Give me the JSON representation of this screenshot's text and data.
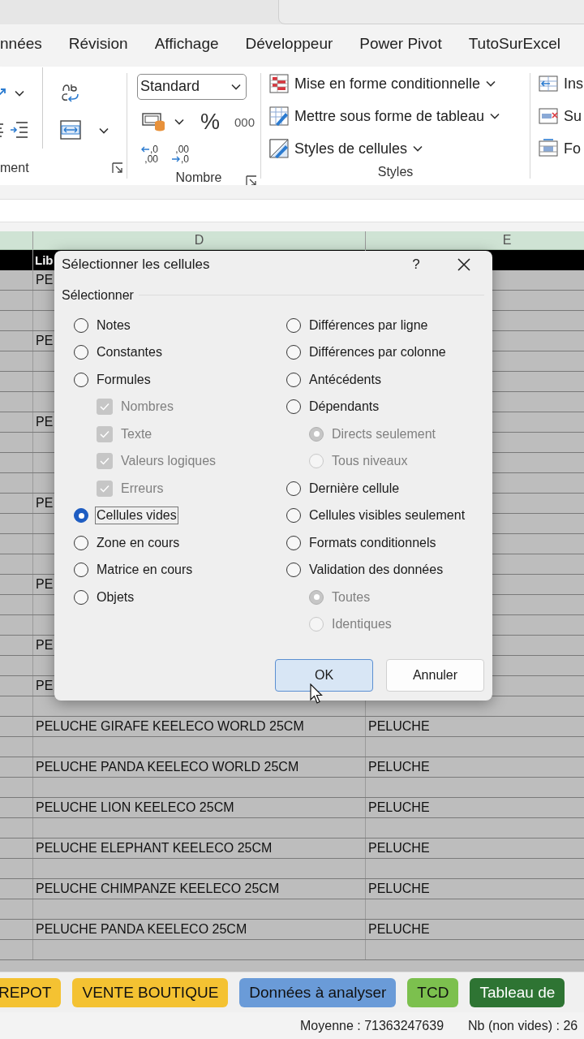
{
  "menu_tabs": [
    {
      "label": "nnées",
      "selected": false
    },
    {
      "label": "Révision",
      "selected": false
    },
    {
      "label": "Affichage",
      "selected": false
    },
    {
      "label": "Développeur",
      "selected": false
    },
    {
      "label": "Power Pivot",
      "selected": false
    },
    {
      "label": "TutoSurExcel",
      "selected": false
    }
  ],
  "ribbon": {
    "groups": [
      {
        "kind": "alignment",
        "label": "ment"
      },
      {
        "kind": "number",
        "label": "Nombre",
        "format": "Standard",
        "percent": "%",
        "thousands": "000",
        "decimal_buttons": [
          {
            "lines": [
              ",0",
              ",00"
            ]
          },
          {
            "lines": [
              ",00",
              ",0"
            ]
          }
        ]
      },
      {
        "kind": "styles",
        "label": "Styles",
        "items": [
          "Mise en forme conditionnelle",
          "Mettre sous forme de tableau",
          "Styles de cellules"
        ]
      },
      {
        "kind": "cells",
        "items": [
          "Ins",
          "Su",
          "Fo"
        ]
      }
    ]
  },
  "sheet": {
    "columns": [
      "D",
      "E"
    ],
    "header": "Lib",
    "rows": [
      {
        "d": "PE"
      },
      {},
      {},
      {
        "d": "PE"
      },
      {},
      {},
      {},
      {
        "d": "PE"
      },
      {},
      {},
      {},
      {
        "d": "PE"
      },
      {},
      {},
      {},
      {
        "d": "PE"
      },
      {},
      {},
      {
        "d": "PE"
      },
      {},
      {
        "d": "PE"
      },
      {},
      {
        "d": "PELUCHE GIRAFE KEELECO WORLD 25CM",
        "e": "PELUCHE"
      },
      {},
      {
        "d": "PELUCHE PANDA KEELECO WORLD 25CM",
        "e": "PELUCHE"
      },
      {},
      {
        "d": "PELUCHE LION KEELECO 25CM",
        "e": "PELUCHE"
      },
      {},
      {
        "d": "PELUCHE ELEPHANT KEELECO 25CM",
        "e": "PELUCHE"
      },
      {},
      {
        "d": "PELUCHE CHIMPANZE KEELECO 25CM",
        "e": "PELUCHE"
      },
      {},
      {
        "d": "PELUCHE PANDA KEELECO 25CM",
        "e": "PELUCHE"
      },
      {}
    ]
  },
  "dialog": {
    "title": "Sélectionner les cellules",
    "help_button": "?",
    "group_label": "Sélectionner",
    "columns": [
      [
        {
          "kind": "radio",
          "label": "Notes",
          "selected": false,
          "disabled": false,
          "focused": false
        },
        {
          "kind": "radio",
          "label": "Constantes",
          "selected": false,
          "disabled": false,
          "focused": false
        },
        {
          "kind": "radio",
          "label": "Formules",
          "selected": false,
          "disabled": false,
          "focused": false,
          "children": [
            {
              "kind": "checkbox",
              "label": "Nombres",
              "checked": true,
              "disabled": true,
              "focused": false
            },
            {
              "kind": "checkbox",
              "label": "Texte",
              "checked": true,
              "disabled": true,
              "focused": false
            },
            {
              "kind": "checkbox",
              "label": "Valeurs logiques",
              "checked": true,
              "disabled": true,
              "focused": false
            },
            {
              "kind": "checkbox",
              "label": "Erreurs",
              "checked": true,
              "disabled": true,
              "focused": false
            }
          ]
        },
        {
          "kind": "radio",
          "label": "Cellules vides",
          "selected": true,
          "disabled": false,
          "focused": true
        },
        {
          "kind": "radio",
          "label": "Zone en cours",
          "selected": false,
          "disabled": false,
          "focused": false
        },
        {
          "kind": "radio",
          "label": "Matrice en cours",
          "selected": false,
          "disabled": false,
          "focused": false
        },
        {
          "kind": "radio",
          "label": "Objets",
          "selected": false,
          "disabled": false,
          "focused": false
        }
      ],
      [
        {
          "kind": "radio",
          "label": "Différences par ligne",
          "selected": false,
          "disabled": false,
          "focused": false
        },
        {
          "kind": "radio",
          "label": "Différences par colonne",
          "selected": false,
          "disabled": false,
          "focused": false
        },
        {
          "kind": "radio",
          "label": "Antécédents",
          "selected": false,
          "disabled": false,
          "focused": false
        },
        {
          "kind": "radio",
          "label": "Dépendants",
          "selected": false,
          "disabled": false,
          "focused": false,
          "children": [
            {
              "kind": "radio",
              "label": "Directs seulement",
              "selected": true,
              "disabled": true,
              "focused": false
            },
            {
              "kind": "radio",
              "label": "Tous niveaux",
              "selected": false,
              "disabled": true,
              "focused": false
            }
          ]
        },
        {
          "kind": "radio",
          "label": "Dernière cellule",
          "selected": false,
          "disabled": false,
          "focused": false
        },
        {
          "kind": "radio",
          "label": "Cellules visibles seulement",
          "selected": false,
          "disabled": false,
          "focused": false
        },
        {
          "kind": "radio",
          "label": "Formats conditionnels",
          "selected": false,
          "disabled": false,
          "focused": false
        },
        {
          "kind": "radio",
          "label": "Validation des données",
          "selected": false,
          "disabled": false,
          "focused": false,
          "children": [
            {
              "kind": "radio",
              "label": "Toutes",
              "selected": true,
              "disabled": true,
              "focused": false
            },
            {
              "kind": "radio",
              "label": "Identiques",
              "selected": false,
              "disabled": true,
              "focused": false
            }
          ]
        }
      ]
    ],
    "buttons": [
      {
        "label": "OK",
        "default": true
      },
      {
        "label": "Annuler",
        "default": false
      }
    ]
  },
  "sheet_tabs": [
    {
      "label": "REPOT",
      "color": "#f4c232"
    },
    {
      "label": "VENTE BOUTIQUE",
      "color": "#f4c232"
    },
    {
      "label": "Données à analyser",
      "color": "#6a9bd8"
    },
    {
      "label": "TCD",
      "color": "#7cc04e"
    },
    {
      "label": "Tableau de",
      "color": "#2e7433"
    }
  ],
  "status_bar": [
    "Moyenne : 71363247639",
    "Nb (non vides) : 26"
  ]
}
